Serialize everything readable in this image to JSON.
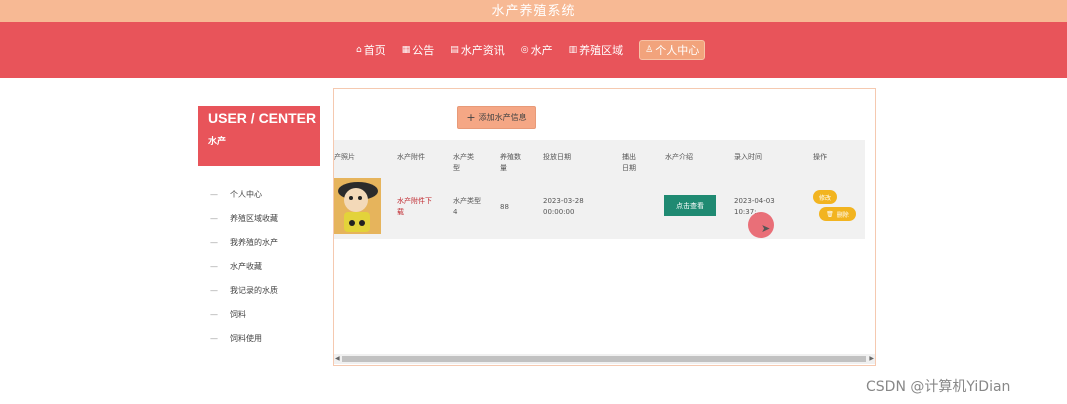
{
  "app": {
    "title": "水产养殖系统"
  },
  "nav": {
    "items": [
      {
        "icon": "⌂",
        "label": "首页",
        "active": false
      },
      {
        "icon": "▦",
        "label": "公告",
        "active": false
      },
      {
        "icon": "▤",
        "label": "水产资讯",
        "active": false
      },
      {
        "icon": "◎",
        "label": "水产",
        "active": false
      },
      {
        "icon": "▥",
        "label": "养殖区域",
        "active": false
      },
      {
        "icon": "♙",
        "label": "个人中心",
        "active": true
      }
    ]
  },
  "user_center": {
    "heading": "USER / CENTER",
    "subheading": "水产",
    "menu": [
      "个人中心",
      "养殖区域收藏",
      "我养殖的水产",
      "水产收藏",
      "我记录的水质",
      "饲料",
      "饲料使用"
    ]
  },
  "toolbar": {
    "add_label": "添加水产信息"
  },
  "table": {
    "headers": [
      "产照片",
      "水产附件",
      "水产类型",
      "养殖数量",
      "投放日期",
      "捕出日期",
      "水产介绍",
      "录入时间",
      "操作"
    ],
    "rows": [
      {
        "attachment": "水产附件下载",
        "type": "水产类型4",
        "quantity": "88",
        "release_date": "2023-03-28 00:00:00",
        "catch_date": "",
        "intro_button": "点击查看",
        "entry_time": "2023-04-03 10:37:..",
        "edit_label": "修改",
        "delete_label": "删除"
      }
    ]
  },
  "watermark": "CSDN @计算机YiDian",
  "colors": {
    "header": "#e8545a",
    "topbar": "#f7b994",
    "accent": "#f5a785",
    "view_button": "#1f8a72",
    "action_button": "#f2b420"
  }
}
